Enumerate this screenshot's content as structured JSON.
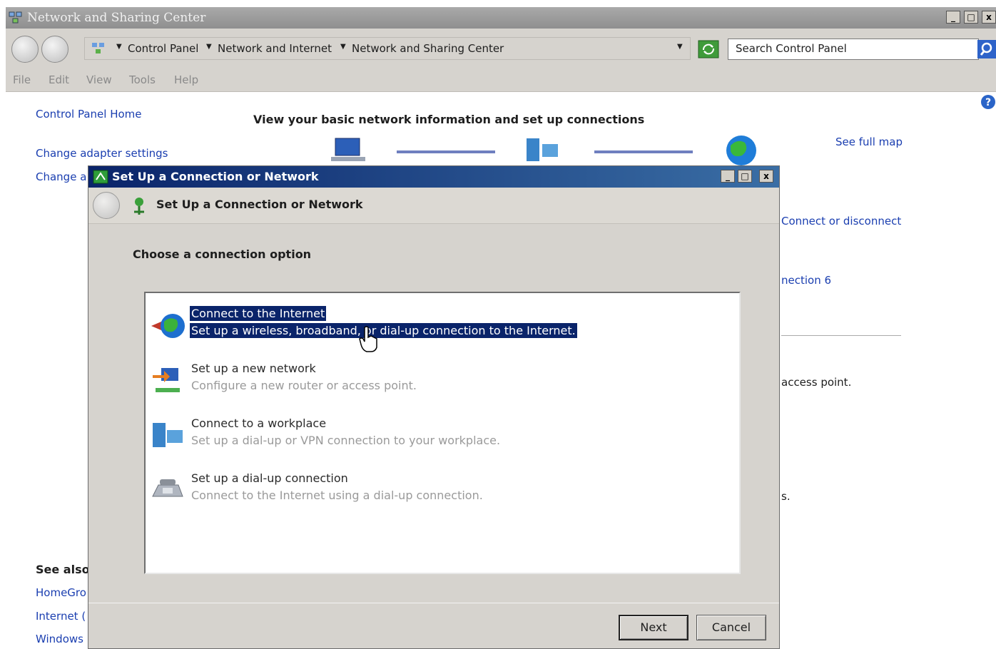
{
  "main_window": {
    "title": "Network and Sharing Center",
    "controls": {
      "minimize": "_",
      "maximize": "□",
      "close": "x"
    },
    "breadcrumb": [
      "Control Panel",
      "Network and Internet",
      "Network and Sharing Center"
    ],
    "search_placeholder": "Search Control Panel",
    "menu": [
      "File",
      "Edit",
      "View",
      "Tools",
      "Help"
    ],
    "sidebar": {
      "home": "Control Panel Home",
      "links": [
        "Change adapter settings",
        "Change a"
      ],
      "see_also_heading": "See also",
      "see_also": [
        "HomeGro",
        "Internet (",
        "Windows"
      ]
    },
    "heading": "View your basic network information and set up connections",
    "see_full_map": "See full map",
    "right_fragments": [
      "Connect or disconnect",
      "nection 6",
      "access point.",
      "s."
    ]
  },
  "dialog": {
    "title": "Set Up a Connection or Network",
    "header_title": "Set Up a Connection or Network",
    "prompt": "Choose a connection option",
    "options": [
      {
        "title": "Connect to the Internet",
        "desc": "Set up a wireless, broadband, or dial-up connection to the Internet.",
        "icon": "globe-internet-icon",
        "selected": true
      },
      {
        "title": "Set up a new network",
        "desc": "Configure a new router or access point.",
        "icon": "new-network-icon",
        "selected": false
      },
      {
        "title": "Connect to a workplace",
        "desc": "Set up a dial-up or VPN connection to your workplace.",
        "icon": "workplace-icon",
        "selected": false
      },
      {
        "title": "Set up a dial-up connection",
        "desc": "Connect to the Internet using a dial-up connection.",
        "icon": "dialup-phone-icon",
        "selected": false
      }
    ],
    "next_label": "Next",
    "cancel_label": "Cancel"
  },
  "colors": {
    "selection": "#0a246a",
    "link": "#1a3eb0",
    "chrome": "#d6d3ce"
  }
}
